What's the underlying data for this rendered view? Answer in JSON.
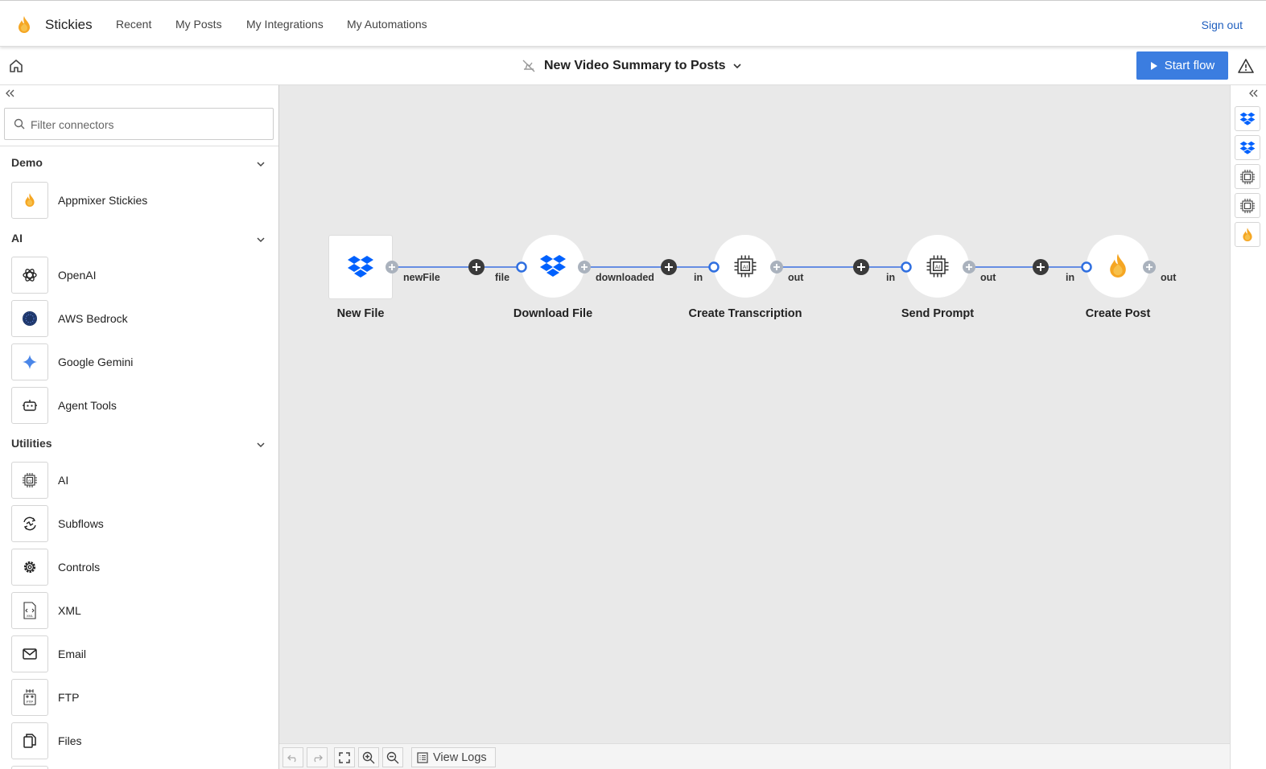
{
  "app": {
    "name": "Stickies"
  },
  "nav": {
    "links": [
      "Recent",
      "My Posts",
      "My Integrations",
      "My Automations"
    ],
    "sign_out": "Sign out"
  },
  "flow": {
    "title": "New Video Summary to Posts",
    "start_label": "Start flow"
  },
  "sidebar": {
    "filter_placeholder": "Filter connectors",
    "sections": [
      {
        "title": "Demo",
        "items": [
          {
            "label": "Appmixer Stickies",
            "icon": "firebase-icon"
          }
        ]
      },
      {
        "title": "AI",
        "items": [
          {
            "label": "OpenAI",
            "icon": "openai-icon"
          },
          {
            "label": "AWS Bedrock",
            "icon": "aws-bedrock-icon"
          },
          {
            "label": "Google Gemini",
            "icon": "gemini-icon"
          },
          {
            "label": "Agent Tools",
            "icon": "robot-icon"
          }
        ]
      },
      {
        "title": "Utilities",
        "items": [
          {
            "label": "AI",
            "icon": "ai-chip-icon"
          },
          {
            "label": "Subflows",
            "icon": "subflows-icon"
          },
          {
            "label": "Controls",
            "icon": "gear-icon"
          },
          {
            "label": "XML",
            "icon": "xml-file-icon"
          },
          {
            "label": "Email",
            "icon": "envelope-icon"
          },
          {
            "label": "FTP",
            "icon": "ftp-icon"
          },
          {
            "label": "Files",
            "icon": "files-icon"
          }
        ]
      }
    ]
  },
  "nodes": [
    {
      "label": "New File",
      "icon": "dropbox-icon",
      "in": "",
      "out": "newFile"
    },
    {
      "label": "Download File",
      "icon": "dropbox-icon",
      "in": "file",
      "out": "downloaded"
    },
    {
      "label": "Create Transcription",
      "icon": "ai-chip-icon",
      "in": "in",
      "out": "out"
    },
    {
      "label": "Send Prompt",
      "icon": "ai-chip-icon",
      "in": "in",
      "out": "out"
    },
    {
      "label": "Create Post",
      "icon": "firebase-icon",
      "in": "in",
      "out": "out"
    }
  ],
  "bottom": {
    "view_logs": "View Logs"
  },
  "colors": {
    "accent": "#3b7de0",
    "link": "#1f5fbf",
    "edge": "#3b6fe0",
    "dropbox": "#0061fe",
    "firebase": "#f5a623"
  }
}
